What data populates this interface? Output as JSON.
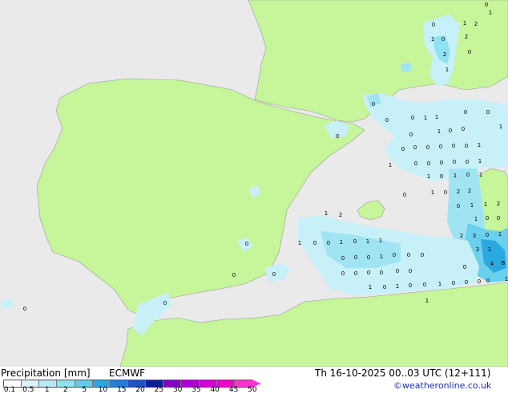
{
  "title": "Precipitation [mm]",
  "model": "ECMWF",
  "valid_time": "Th 16-10-2025 00..03 UTC (12+111)",
  "credit": "©weatheronline.co.uk",
  "colors": {
    "sea": "#eaeaea",
    "land": "#c6f59a",
    "precip_light": "#c8f0f8",
    "precip_mid": "#a0e4f4",
    "precip_heavy": "#6ad0ee",
    "precip_strong": "#2aa8e0"
  },
  "legend": {
    "ticks": [
      "0.1",
      "0.5",
      "1",
      "2",
      "5",
      "10",
      "15",
      "20",
      "25",
      "30",
      "35",
      "40",
      "45",
      "50"
    ],
    "colors": [
      "#fdfdfd",
      "#d8f4f8",
      "#b4ecf6",
      "#8ee2f2",
      "#5fcbed",
      "#2ea6e6",
      "#1e7fdc",
      "#1a55c8",
      "#0a1e96",
      "#8800c4",
      "#b000d4",
      "#d400d4",
      "#f000cc",
      "#ff30d8"
    ]
  },
  "values": [
    "0",
    "1",
    "0",
    "2",
    "1",
    "1",
    "2",
    "2",
    "0",
    "0",
    "1",
    "0",
    "0",
    "0",
    "1",
    "1",
    "0",
    "0",
    "1",
    "0",
    "1",
    "0",
    "0",
    "0",
    "0",
    "0",
    "0",
    "0",
    "0",
    "1",
    "1",
    "0",
    "0",
    "0",
    "0",
    "0",
    "1",
    "1",
    "0",
    "1",
    "0",
    "1",
    "0",
    "1",
    "0",
    "2",
    "2",
    "0",
    "1",
    "1",
    "2",
    "1",
    "0",
    "0",
    "2",
    "3",
    "0",
    "1",
    "3",
    "1",
    "4",
    "8",
    "0",
    "1",
    "2",
    "0",
    "1",
    "1",
    "0",
    "0",
    "1",
    "0",
    "1",
    "1",
    "0",
    "0",
    "0",
    "1",
    "0",
    "0",
    "0",
    "0",
    "0",
    "0",
    "0",
    "0",
    "0",
    "1",
    "0",
    "1",
    "0",
    "0",
    "1",
    "0",
    "0",
    "0",
    "1",
    "0",
    "0",
    "0",
    "0",
    "0",
    "0"
  ]
}
